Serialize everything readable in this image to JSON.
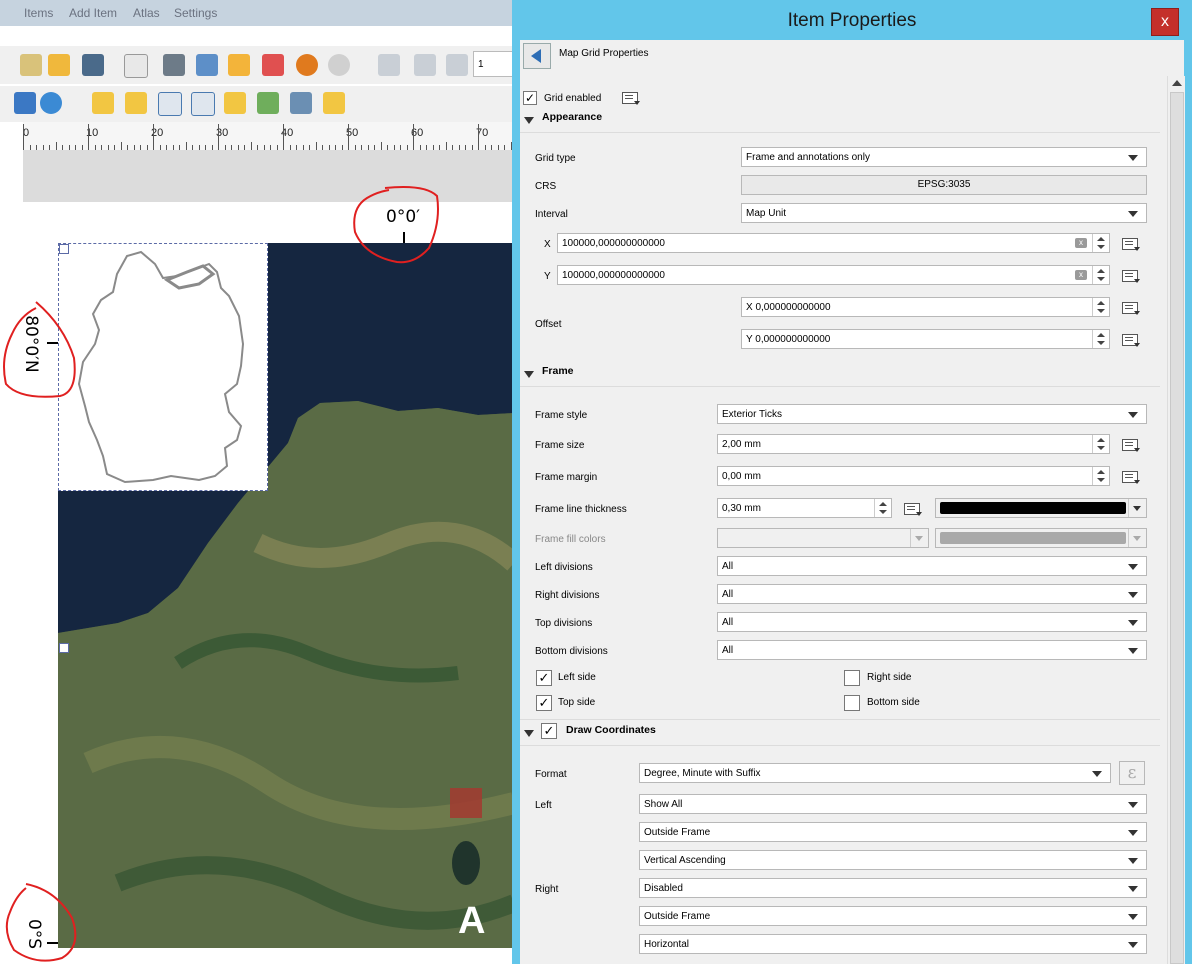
{
  "menubar": {
    "items": [
      "Items",
      "Add Item",
      "Atlas",
      "Settings"
    ]
  },
  "toolbar": {
    "page_field": "1"
  },
  "ruler": {
    "labels": [
      "0",
      "10",
      "20",
      "30",
      "40",
      "50",
      "60",
      "70"
    ]
  },
  "map_canvas": {
    "top_label": "0°0′",
    "left_label": "80°0′N",
    "bottom_left_label": "0°S",
    "corner_letter": "A"
  },
  "dialog": {
    "title": "Item Properties",
    "close_label": "x",
    "panel_title": "Map Grid Properties",
    "grid_enabled_label": "Grid enabled",
    "appearance": {
      "section_label": "Appearance",
      "grid_type_label": "Grid type",
      "grid_type_value": "Frame and annotations only",
      "crs_label": "CRS",
      "crs_value": "EPSG:3035",
      "interval_label": "Interval",
      "interval_value": "Map Unit",
      "x_label": "X",
      "x_value": "100000,000000000000",
      "y_label": "Y",
      "y_value": "100000,000000000000",
      "offset_label": "Offset",
      "offset_x_value": "X 0,000000000000",
      "offset_y_value": "Y 0,000000000000"
    },
    "frame": {
      "section_label": "Frame",
      "style_label": "Frame style",
      "style_value": "Exterior Ticks",
      "size_label": "Frame size",
      "size_value": "2,00 mm",
      "margin_label": "Frame margin",
      "margin_value": "0,00 mm",
      "thickness_label": "Frame line thickness",
      "thickness_value": "0,30 mm",
      "line_color": "#000000",
      "fill_label": "Frame fill colors",
      "fill_color": "#a9a9a9",
      "left_div_label": "Left divisions",
      "left_div_value": "All",
      "right_div_label": "Right divisions",
      "right_div_value": "All",
      "top_div_label": "Top divisions",
      "top_div_value": "All",
      "bottom_div_label": "Bottom divisions",
      "bottom_div_value": "All",
      "left_side_label": "Left side",
      "right_side_label": "Right side",
      "top_side_label": "Top side",
      "bottom_side_label": "Bottom side"
    },
    "draw_coordinates": {
      "section_label": "Draw Coordinates",
      "format_label": "Format",
      "format_value": "Degree, Minute with Suffix",
      "left_label": "Left",
      "left_show": "Show All",
      "left_position": "Outside Frame",
      "left_direction": "Vertical Ascending",
      "right_label": "Right",
      "right_show": "Disabled",
      "right_position": "Outside Frame",
      "right_direction": "Horizontal"
    }
  },
  "colors": {
    "dialog_titlebar": "#62c6ea",
    "close_button": "#c4302b",
    "annotation_red": "#e02020"
  }
}
